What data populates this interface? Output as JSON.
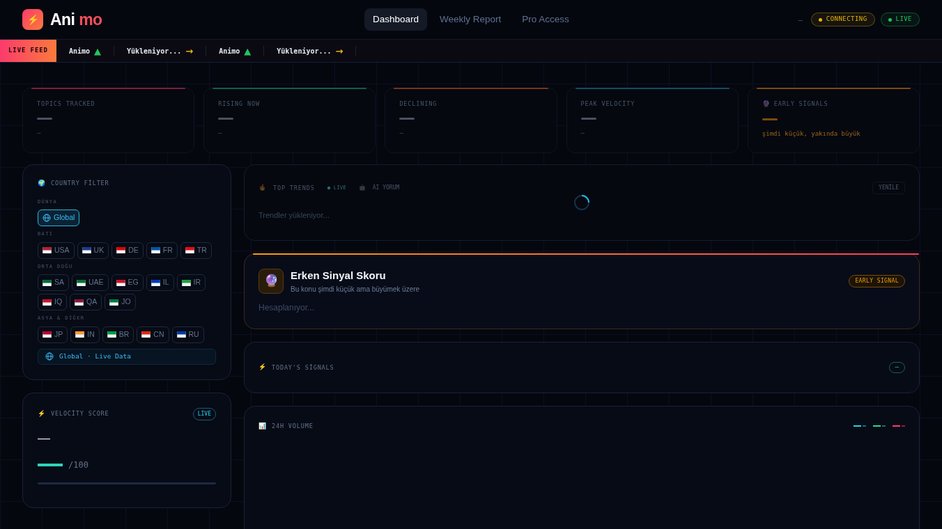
{
  "brand": {
    "part_1": "Ani",
    "part_2": "mo",
    "icon": "⚡"
  },
  "nav": [
    {
      "label": "Dashboard",
      "selected": true
    },
    {
      "label": "Weekly Report",
      "selected": false
    },
    {
      "label": "Pro Access",
      "selected": false
    }
  ],
  "status": {
    "dash": "–",
    "badges": [
      {
        "label": "CONNECTING",
        "color": "#eab308"
      },
      {
        "label": "LIVE",
        "color": "#22c55e"
      }
    ]
  },
  "ticker": {
    "label": "LIVE FEED",
    "items": [
      {
        "name": "Animo",
        "arrow": "▲",
        "color": "#22c55e"
      },
      {
        "name": "Yükleniyor...",
        "arrow": "→",
        "color": "#eab308"
      },
      {
        "name": "Animo",
        "arrow": "▲",
        "color": "#22c55e"
      },
      {
        "name": "Yükleniyor...",
        "arrow": "→",
        "color": "#eab308"
      }
    ]
  },
  "stats": [
    {
      "label": "TOPICS TRACKED",
      "sub": "–",
      "color": "#7a1f3d"
    },
    {
      "label": "RISING NOW",
      "sub": "–",
      "color": "#0f5e4a"
    },
    {
      "label": "DECLINING",
      "sub": "–",
      "color": "#7a3418"
    },
    {
      "label": "PEAK VELOCİTY",
      "sub": "–",
      "color": "#0e4e63"
    },
    {
      "label": "EARLY SİGNALS",
      "icon": "🔮",
      "sub": "şimdi küçük, yakında büyük",
      "color": "#7a4a12"
    }
  ],
  "country_filter": {
    "icon": "🌍",
    "title": "COUNTRY FİLTER",
    "groups": [
      {
        "label": "DÜNYA",
        "items": [
          {
            "label": "Global",
            "kind": "globe",
            "selected": true
          }
        ]
      },
      {
        "label": "BATI",
        "items": [
          {
            "label": "USA",
            "kind": "flag",
            "color": "#b22234",
            "selected": false
          },
          {
            "label": "UK",
            "kind": "flag",
            "color": "#1e3a8a",
            "selected": false
          },
          {
            "label": "DE",
            "kind": "flag",
            "color": "#dd0000",
            "selected": false
          },
          {
            "label": "FR",
            "kind": "flag",
            "color": "#0055a4",
            "selected": false
          },
          {
            "label": "TR",
            "kind": "flag",
            "color": "#e30a17",
            "selected": false
          }
        ]
      },
      {
        "label": "ORTA DOĞU",
        "items": [
          {
            "label": "SA",
            "kind": "flag",
            "color": "#006c35",
            "selected": false
          },
          {
            "label": "UAE",
            "kind": "flag",
            "color": "#00732f",
            "selected": false
          },
          {
            "label": "EG",
            "kind": "flag",
            "color": "#ce1126",
            "selected": false
          },
          {
            "label": "IL",
            "kind": "flag",
            "color": "#0038b8",
            "selected": false
          },
          {
            "label": "IR",
            "kind": "flag",
            "color": "#239f40",
            "selected": false
          },
          {
            "label": "IQ",
            "kind": "flag",
            "color": "#ce1126",
            "selected": false
          },
          {
            "label": "QA",
            "kind": "flag",
            "color": "#8a1538",
            "selected": false
          },
          {
            "label": "JO",
            "kind": "flag",
            "color": "#007a3d",
            "selected": false
          }
        ]
      },
      {
        "label": "ASYA & DİĞER",
        "items": [
          {
            "label": "JP",
            "kind": "flag",
            "color": "#bc002d",
            "selected": false
          },
          {
            "label": "IN",
            "kind": "flag",
            "color": "#ff9933",
            "selected": false
          },
          {
            "label": "BR",
            "kind": "flag",
            "color": "#009c3b",
            "selected": false
          },
          {
            "label": "CN",
            "kind": "flag",
            "color": "#de2910",
            "selected": false
          },
          {
            "label": "RU",
            "kind": "flag",
            "color": "#0039a6",
            "selected": false
          }
        ]
      }
    ],
    "footer": "Global · Live Data"
  },
  "velocity": {
    "icon": "⚡",
    "title": "VELOCİTY SCORE",
    "badge": "LIVE",
    "value": "—",
    "scale": "/100",
    "level": 0
  },
  "top_trends": {
    "icon": "🔥",
    "title": "TOP TRENDS",
    "live": "● LIVE",
    "ai_icon": "🤖",
    "ai": "AI YORUM",
    "button": "YENİLE",
    "loading": "Trendler yükleniyor..."
  },
  "early_signal": {
    "icon": "🔮",
    "title": "Erken Sinyal Skoru",
    "subtitle": "Bu konu şimdi küçük ama büyümek üzere",
    "badge": "EARLY SIGNAL",
    "status": "Hesaplanıyor..."
  },
  "signals": {
    "icon": "⚡",
    "title": "TODAY'S SİGNALS",
    "count": "–"
  },
  "volume": {
    "icon": "📊",
    "title": "24H VOLUME",
    "legend": [
      {
        "color": "#22d3ee"
      },
      {
        "color": "#34d399"
      },
      {
        "color": "#fb3b6b"
      }
    ]
  }
}
